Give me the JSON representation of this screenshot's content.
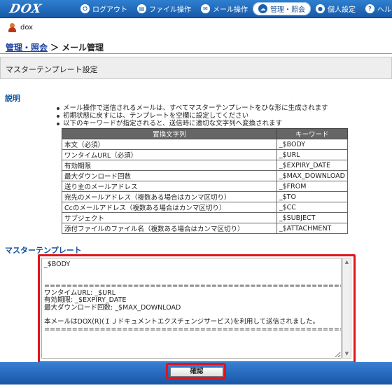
{
  "app": {
    "logo": "DOX",
    "nav": [
      {
        "label": "ログアウト",
        "icon": "logout-icon",
        "glyph": "⏻",
        "active": false
      },
      {
        "label": "ファイル操作",
        "icon": "file-icon",
        "glyph": "▤",
        "active": false
      },
      {
        "label": "メール操作",
        "icon": "mail-icon",
        "glyph": "✉",
        "active": false
      },
      {
        "label": "管理・照会",
        "icon": "cloud-icon",
        "glyph": "☁",
        "active": true
      },
      {
        "label": "個人設定",
        "icon": "person-icon",
        "glyph": "●",
        "active": false
      },
      {
        "label": "ヘルプ",
        "icon": "help-icon",
        "glyph": "?",
        "active": false
      }
    ],
    "user": "dox"
  },
  "breadcrumb": {
    "link": "管理・照会",
    "separator": "＞",
    "current": "メール管理"
  },
  "page_title": "マスターテンプレート設定",
  "explanation": {
    "heading": "説明",
    "bullets": [
      "メール操作で送信されるメールは、すべてマスターテンプレートをひな形に生成されます",
      "初期状態に戻すには、テンプレートを空欄に設定してください",
      "以下のキーワードが指定されると、送信時に適切な文字列へ変換されます"
    ]
  },
  "keyword_table": {
    "headers": [
      "置換文字列",
      "キーワード"
    ],
    "rows": [
      [
        "本文（必須）",
        "_$BODY"
      ],
      [
        "ワンタイムURL（必須）",
        "_$URL"
      ],
      [
        "有効期限",
        "_$EXPIRY_DATE"
      ],
      [
        "最大ダウンロード回数",
        "_$MAX_DOWNLOAD"
      ],
      [
        "送り主のメールアドレス",
        "_$FROM"
      ],
      [
        "宛先のメールアドレス（複数ある場合はカンマ区切り）",
        "_$TO"
      ],
      [
        "Ccのメールアドレス（複数ある場合はカンマ区切り）",
        "_$CC"
      ],
      [
        "サブジェクト",
        "_$SUBJECT"
      ],
      [
        "添付ファイルのファイル名（複数ある場合はカンマ区切り）",
        "_$ATTACHMENT"
      ]
    ]
  },
  "template": {
    "heading": "マスターテンプレート",
    "value": "_$BODY\n\n\n==========================================================================================\nワンタイムURL: _$URL\n有効期限: _$EXPIRY_DATE\n最大ダウンロード回数: _$MAX_DOWNLOAD\n\n本メールはDOX(R)(ＩＪドキュメントエクスチェンジサービス)を利用して送信されました。\n=========================================================================================="
  },
  "confirm_label": "確認",
  "colors": {
    "nav_bar": "#1a5fae",
    "heading": "#0d4f9b",
    "highlight": "#e0141a",
    "table_header": "#666666"
  }
}
